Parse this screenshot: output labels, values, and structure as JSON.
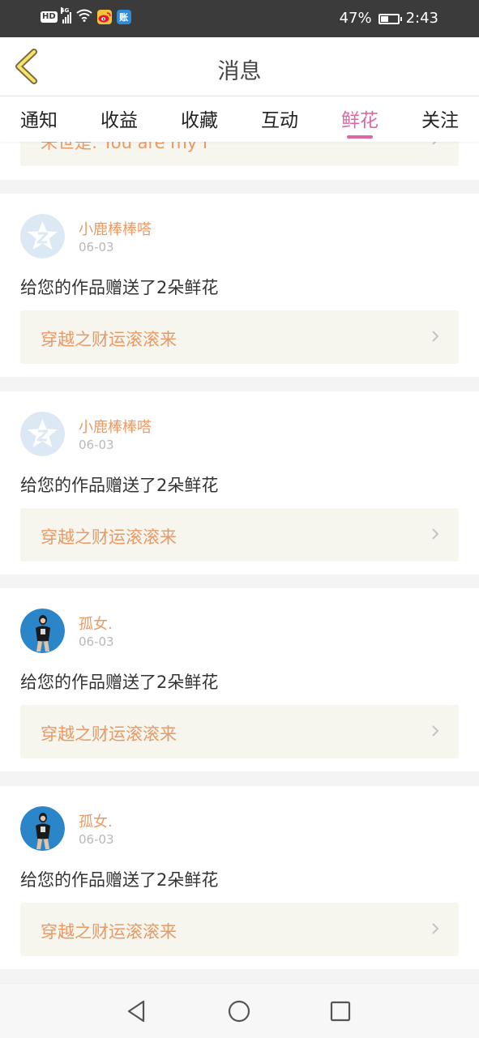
{
  "status_bar": {
    "hd": "HD",
    "network": "4G",
    "battery_text": "47%",
    "battery_level": 0.47,
    "time": "2:43",
    "app_icons": [
      "weibo-icon",
      "alipay-icon"
    ]
  },
  "header": {
    "title": "消息",
    "back_icon": "chevron-left-icon"
  },
  "tabs": [
    {
      "label": "通知",
      "active": false
    },
    {
      "label": "收益",
      "active": false
    },
    {
      "label": "收藏",
      "active": false
    },
    {
      "label": "互动",
      "active": false
    },
    {
      "label": "鲜花",
      "active": true
    },
    {
      "label": "关注",
      "active": false
    }
  ],
  "partial_item": {
    "title": "来世是: You are my I"
  },
  "messages": [
    {
      "user": "小鹿棒棒嗒",
      "date": "06-03",
      "text": "给您的作品赠送了2朵鲜花",
      "work": "穿越之财运滚滚来",
      "avatar": "default-avatar"
    },
    {
      "user": "小鹿棒棒嗒",
      "date": "06-03",
      "text": "给您的作品赠送了2朵鲜花",
      "work": "穿越之财运滚滚来",
      "avatar": "default-avatar"
    },
    {
      "user": "孤女.",
      "date": "06-03",
      "text": "给您的作品赠送了2朵鲜花",
      "work": "穿越之财运滚滚来",
      "avatar": "photo-avatar"
    },
    {
      "user": "孤女.",
      "date": "06-03",
      "text": "给您的作品赠送了2朵鲜花",
      "work": "穿越之财运滚滚来",
      "avatar": "photo-avatar"
    }
  ],
  "nav_bar": {
    "buttons": [
      "back-triangle-icon",
      "home-circle-icon",
      "recents-square-icon"
    ]
  },
  "colors": {
    "accent": "#e066a3",
    "username": "#e89a66",
    "work_bg": "#f6f5ee",
    "statusbar": "#3b3b3b"
  }
}
